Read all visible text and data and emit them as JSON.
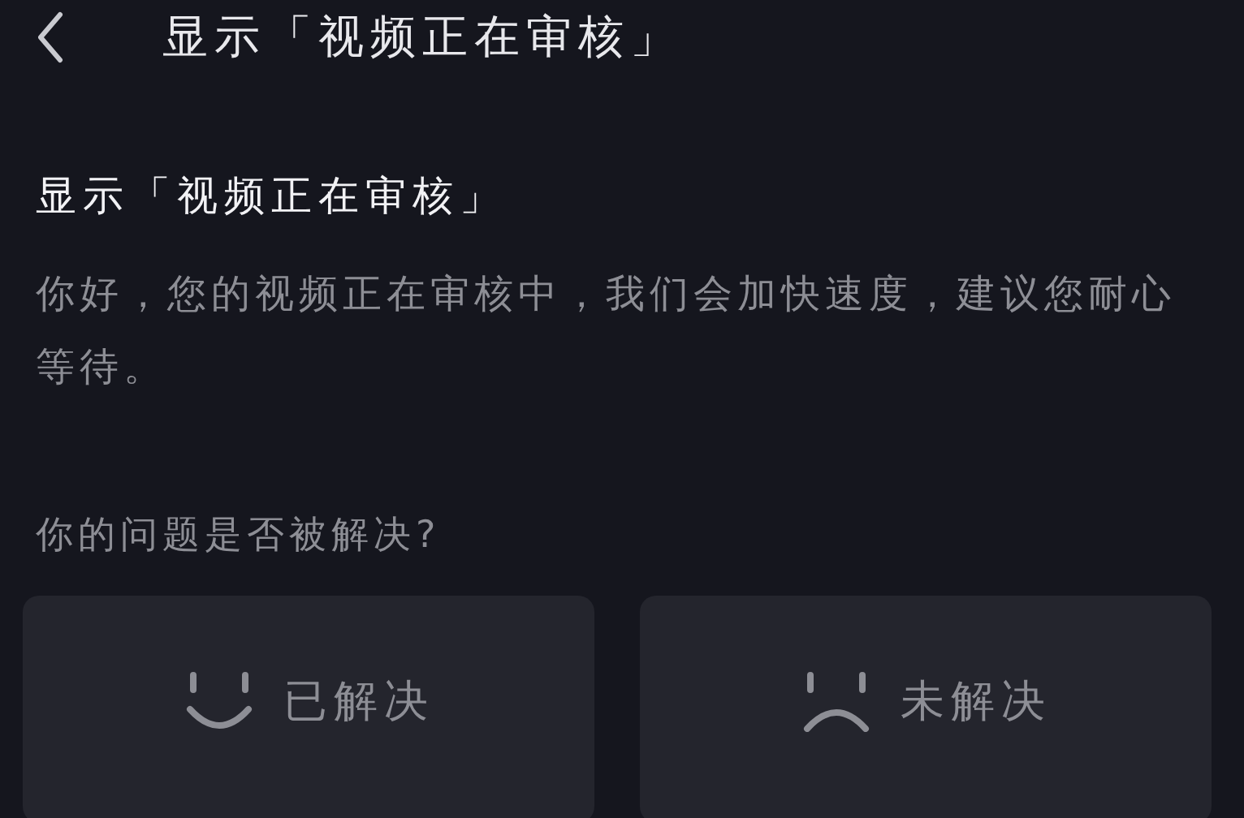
{
  "header": {
    "title": "显示「视频正在审核」"
  },
  "article": {
    "title": "显示「视频正在审核」",
    "body": "你好，您的视频正在审核中，我们会加快速度，建议您耐心等待。"
  },
  "feedback": {
    "question": "你的问题是否被解决?",
    "options": [
      {
        "kind": "solved",
        "label": "已解决"
      },
      {
        "kind": "unsolved",
        "label": "未解决"
      }
    ]
  }
}
